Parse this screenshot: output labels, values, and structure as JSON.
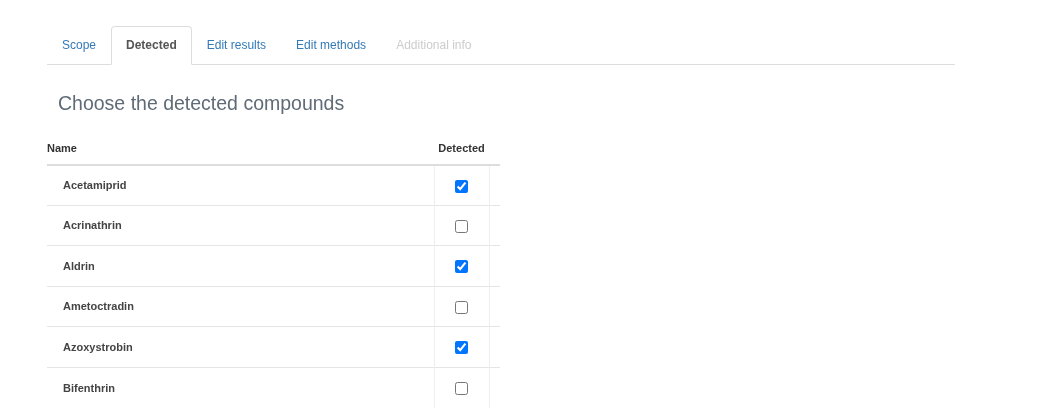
{
  "tabs": [
    {
      "label": "Scope",
      "selected": false,
      "disabled": false
    },
    {
      "label": "Detected",
      "selected": true,
      "disabled": false
    },
    {
      "label": "Edit results",
      "selected": false,
      "disabled": false
    },
    {
      "label": "Edit methods",
      "selected": false,
      "disabled": false
    },
    {
      "label": "Additional info",
      "selected": false,
      "disabled": true
    }
  ],
  "heading": "Choose the detected compounds",
  "table": {
    "columns": [
      "Name",
      "Detected"
    ],
    "rows": [
      {
        "name": "Acetamiprid",
        "checked": true
      },
      {
        "name": "Acrinathrin",
        "checked": false
      },
      {
        "name": "Aldrin",
        "checked": true
      },
      {
        "name": "Ametoctradin",
        "checked": false
      },
      {
        "name": "Azoxystrobin",
        "checked": true
      },
      {
        "name": "Bifenthrin",
        "checked": false
      }
    ]
  }
}
